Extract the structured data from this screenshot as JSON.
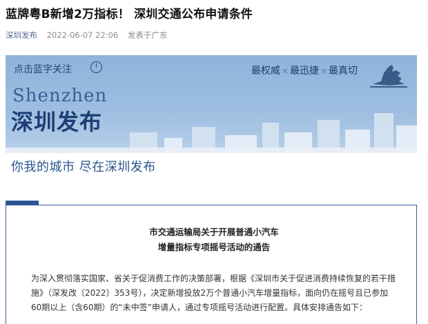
{
  "article": {
    "title": "蓝牌粤B新增2万指标！ 深圳交通公布申请条件",
    "source": "深圳发布",
    "date": "2022-06-07 22:06",
    "location": "发表于广东"
  },
  "banner": {
    "follow_text": "点击蓝字关注",
    "slogan_1": "最权威",
    "slogan_2": "最迅捷",
    "slogan_3": "最真切",
    "separator": "×",
    "city_en": "Shenzhen",
    "city_cn": "深圳发布",
    "tagline": "你我的城市 尽在深圳发布",
    "colors": {
      "sky": "#8fb4db",
      "text": "#1d3e75"
    }
  },
  "notice": {
    "title_line1": "市交通运输局关于开展普通小汽车",
    "title_line2": "增量指标专项摇号活动的通告",
    "body": "为深入贯彻落实国家、省关于促消费工作的决策部署，根据《深圳市关于促进消费持续恢复的若干措施》（深发改〔2022〕353号），决定新增投放2万个普通小汽车增量指标，面向仍在摇号且已参加60期以上（含60期）的“未中签”申请人，通过专项摇号活动进行配置。具体安排通告如下：",
    "accent_color": "#2b5496"
  }
}
